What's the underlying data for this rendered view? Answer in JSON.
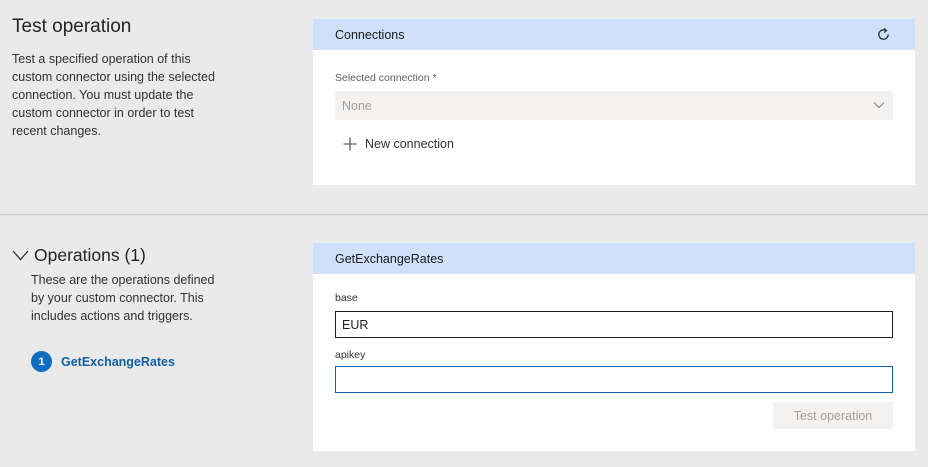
{
  "test_section": {
    "title": "Test operation",
    "description": "Test a specified operation of this custom connector using the selected connection. You must update the custom connector in order to test recent changes."
  },
  "connections_card": {
    "header": "Connections",
    "refresh_icon": "refresh-icon",
    "selected_label": "Selected connection *",
    "selected_value": "None",
    "new_connection_label": "New connection"
  },
  "operations_section": {
    "title": "Operations (1)",
    "description": "These are the operations defined by your custom connector. This includes actions and triggers.",
    "items": [
      {
        "number": "1",
        "name": "GetExchangeRates"
      }
    ]
  },
  "operation_card": {
    "header": "GetExchangeRates",
    "fields": [
      {
        "label": "base",
        "value": "EUR"
      },
      {
        "label": "apikey",
        "value": ""
      }
    ],
    "test_button_label": "Test operation"
  },
  "colors": {
    "accent": "#106ebe",
    "card_header": "#cfe0fa",
    "focus_border": "#0f5fa8"
  }
}
